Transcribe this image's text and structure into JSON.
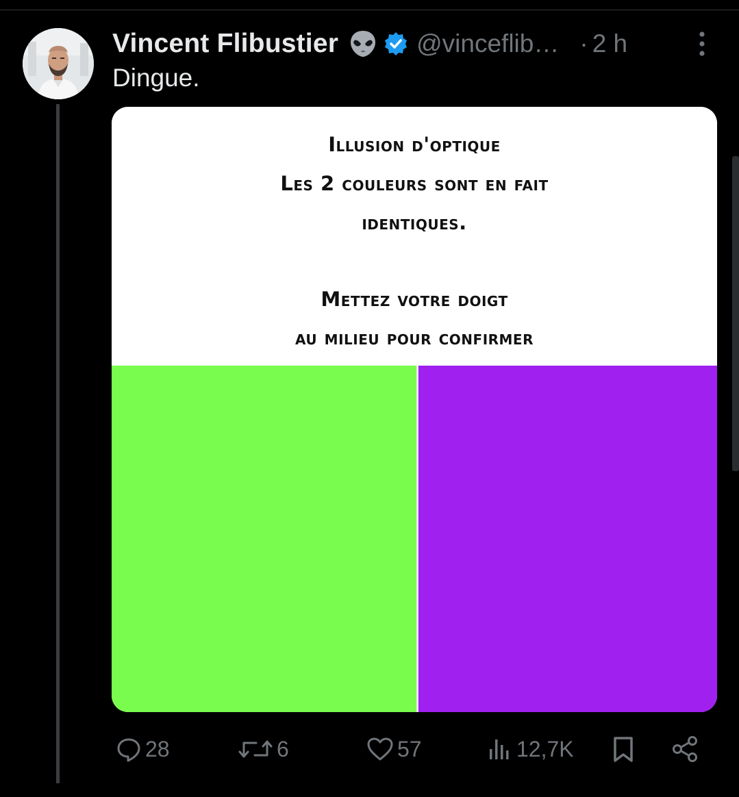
{
  "post": {
    "author_name": "Vincent Flibustier",
    "handle": "@vinceflib…",
    "separator": "·",
    "time": "2 h",
    "text": "Dingue."
  },
  "media": {
    "lines": [
      "Illusion d'optique",
      "Les 2 couleurs sont en fait",
      "identiques.",
      "",
      "Mettez votre doigt",
      "au milieu pour confirmer"
    ],
    "left_color": "#79fc4d",
    "right_color": "#a020f0"
  },
  "actions": {
    "replies": "28",
    "reposts": "6",
    "likes": "57",
    "views": "12,7K"
  },
  "icons": {
    "author_badge": "alien-icon",
    "verified": "verified-icon",
    "more": "more-icon",
    "reply": "reply-icon",
    "repost": "repost-icon",
    "like": "heart-icon",
    "views": "views-icon",
    "bookmark": "bookmark-icon",
    "share": "share-icon"
  },
  "colors": {
    "background": "#000000",
    "text_primary": "#e7e9ea",
    "text_secondary": "#71767b",
    "verified_blue": "#1d9bf0"
  }
}
